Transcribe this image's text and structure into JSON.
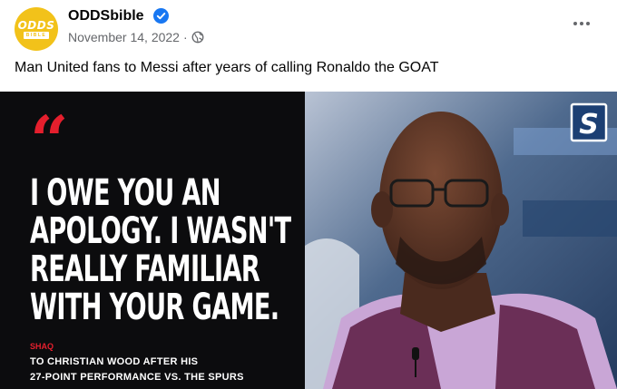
{
  "post": {
    "page_name": "ODDSbible",
    "date": "November 14, 2022",
    "separator": "·",
    "caption": "Man United fans to Messi after years of calling Ronaldo the GOAT"
  },
  "avatar": {
    "line1": "ODDS",
    "line2": "BIBLE"
  },
  "image": {
    "quote_mark": "“",
    "quote_lines": [
      "I OWE YOU AN",
      "APOLOGY. I WASN'T",
      "REALLY FAMILIAR",
      "WITH YOUR GAME."
    ],
    "speaker": "SHAQ",
    "attribution_lines": [
      "TO CHRISTIAN WOOD AFTER HIS",
      "27-POINT PERFORMANCE VS. THE SPURS"
    ],
    "logo": "S"
  },
  "icons": {
    "verified": "verified-badge-icon",
    "globe": "globe-icon",
    "more": "more-options-icon"
  },
  "colors": {
    "brand_yellow": "#f2c21a",
    "verified_blue": "#1877f2",
    "meta_gray": "#65676b",
    "quote_red": "#e51f2d",
    "panel_black": "#0c0c0e"
  }
}
